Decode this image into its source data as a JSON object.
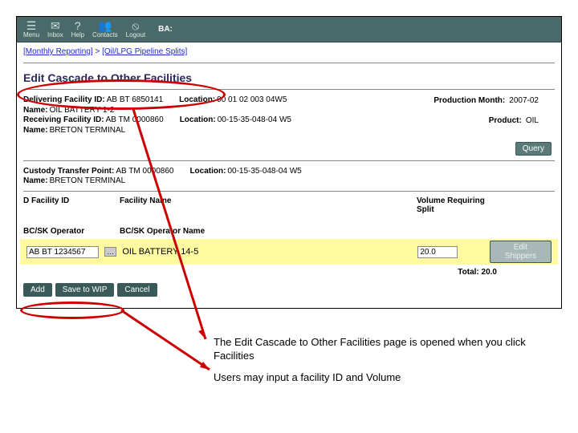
{
  "toolbar": {
    "items": [
      {
        "label": "Menu",
        "icon": "☰"
      },
      {
        "label": "Inbox",
        "icon": "✉"
      },
      {
        "label": "Help",
        "icon": "?"
      },
      {
        "label": "Contacts",
        "icon": "👥"
      },
      {
        "label": "Logout",
        "icon": "⦸"
      }
    ],
    "ba_label": "BA:"
  },
  "breadcrumb": {
    "a": "[Monthly Reporting]",
    "sep": " > ",
    "b": "[Oil/LPG Pipeline Splits]"
  },
  "heading": "Edit Cascade to Other Facilities",
  "delivering": {
    "label": "Delivering Facility ID:",
    "id": "AB BT 6850141",
    "loc_label": "Location:",
    "loc": "00 01 02 003 04W5",
    "pm_label": "Production Month:",
    "pm": "2007-02",
    "name_label": "Name:",
    "name": "OIL BATTERY 1-2"
  },
  "receiving": {
    "label": "Receiving Facility ID:",
    "id": "AB TM 0000860",
    "loc_label": "Location:",
    "loc": "00-15-35-048-04 W5",
    "prod_label": "Product:",
    "prod": "OIL",
    "name_label": "Name:",
    "name": "BRETON TERMINAL"
  },
  "query_button": "Query",
  "custody": {
    "label": "Custody Transfer Point:",
    "id": "AB TM 0000860",
    "loc_label": "Location:",
    "loc": "00-15-35-048-04 W5",
    "name_label": "Name:",
    "name": "BRETON TERMINAL"
  },
  "columns": {
    "c1": "D Facility ID",
    "c2": "Facility Name",
    "c4": "Volume Requiring Split"
  },
  "columns2": {
    "c1": "BC/SK Operator",
    "c2": "BC/SK Operator Name"
  },
  "row": {
    "facility_id": "AB BT 1234567",
    "facility_name": "OIL BATTERY 14-5",
    "volume": "20.0",
    "edit_button": "Edit Shippers"
  },
  "total": {
    "label": "Total:",
    "value": "20.0"
  },
  "actions": {
    "add": "Add",
    "save": "Save to WIP",
    "cancel": "Cancel"
  },
  "annotations": {
    "a1": "The Edit Cascade to Other Facilities page is opened when you click Facilities",
    "a2": "Users may input a facility ID and Volume"
  }
}
